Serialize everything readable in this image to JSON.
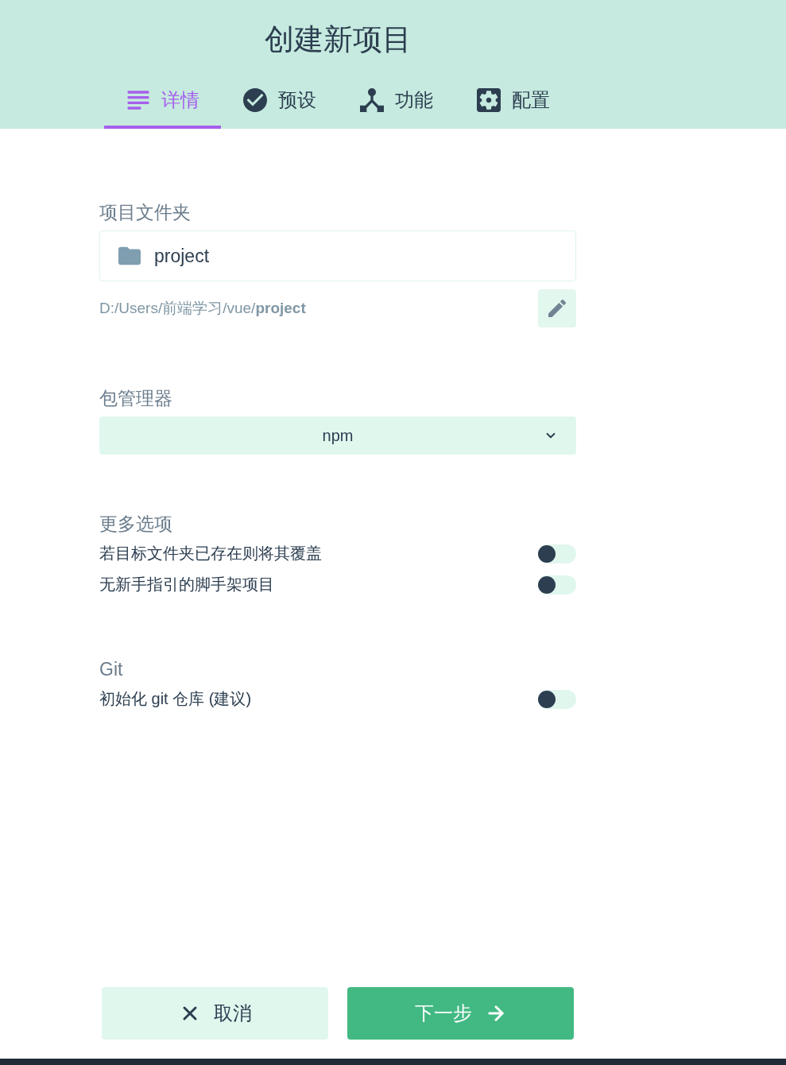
{
  "header": {
    "title": "创建新项目",
    "tabs": [
      {
        "label": "详情",
        "selected": true
      },
      {
        "label": "预设",
        "selected": false
      },
      {
        "label": "功能",
        "selected": false
      },
      {
        "label": "配置",
        "selected": false
      }
    ]
  },
  "project_folder": {
    "label": "项目文件夹",
    "value": "project",
    "path": "D:/Users/前端学习/vue/**project**"
  },
  "package_manager": {
    "label": "包管理器",
    "value": "npm"
  },
  "more_options": {
    "label": "更多选项",
    "options": [
      {
        "label": "若目标文件夹已存在则将其覆盖",
        "on": false
      },
      {
        "label": "无新手指引的脚手架项目",
        "on": false
      }
    ]
  },
  "git": {
    "label": "Git",
    "options": [
      {
        "label": "初始化 git 仓库 (建议)",
        "on": false
      }
    ]
  },
  "buttons": [
    {
      "label": "取消",
      "kind": "secondary"
    },
    {
      "label": "下一步",
      "kind": "primary"
    }
  ]
}
